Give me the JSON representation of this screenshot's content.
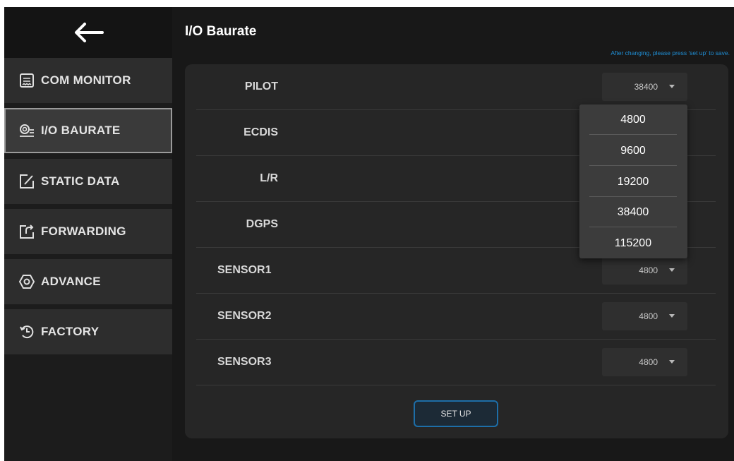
{
  "header": {
    "title": "I/O Baurate",
    "hint": "After changing, please press 'set up' to save."
  },
  "sidebar": {
    "items": [
      {
        "label": "COM MONITOR",
        "icon": "receipt-icon",
        "active": false
      },
      {
        "label": "I/O BAURATE",
        "icon": "io-settings-icon",
        "active": true
      },
      {
        "label": "STATIC DATA",
        "icon": "edit-icon",
        "active": false
      },
      {
        "label": "FORWARDING",
        "icon": "forward-icon",
        "active": false
      },
      {
        "label": "ADVANCE",
        "icon": "hexagon-icon",
        "active": false
      },
      {
        "label": "FACTORY",
        "icon": "restore-icon",
        "active": false
      }
    ]
  },
  "ports": [
    {
      "label": "PILOT",
      "value": "38400"
    },
    {
      "label": "ECDIS",
      "value": ""
    },
    {
      "label": "L/R",
      "value": ""
    },
    {
      "label": "DGPS",
      "value": ""
    },
    {
      "label": "SENSOR1",
      "value": "4800"
    },
    {
      "label": "SENSOR2",
      "value": "4800"
    },
    {
      "label": "SENSOR3",
      "value": "4800"
    }
  ],
  "dropdown": {
    "options": [
      "4800",
      "9600",
      "19200",
      "38400",
      "115200"
    ]
  },
  "buttons": {
    "setup": "SET UP"
  },
  "colors": {
    "accent": "#1f8fd6",
    "button_border": "#1d6ea8",
    "panel": "#262626",
    "sidebar_item": "#2d2d2d"
  }
}
